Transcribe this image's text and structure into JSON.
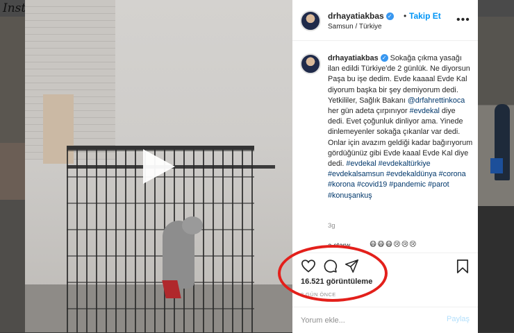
{
  "background": {
    "app_logo": "Instagram",
    "accent_annotation": "#e3201b"
  },
  "post": {
    "header": {
      "username": "drhayatiakbas",
      "verified_icon": "verified-badge-icon",
      "separator": "•",
      "follow_label": "Takip Et",
      "location": "Samsun / Türkiye",
      "more_icon": "more-options-icon"
    },
    "caption": {
      "username": "drhayatiakbas",
      "text_1": " Sokağa çıkma yasağı ilan edildi Türkiye'de 2 günlük. Ne diyorsun Paşa bu işe dedim. Evde kaaaal Evde Kal diyorum başka bir şey demiyorum dedi. Yetkililer, Sağlık Bakanı ",
      "mention": "@drfahrettinkoca",
      "text_2": " her gün adeta çırpınıyor ",
      "hashtag_1": "#evdekal",
      "text_3": " diye dedi. Evet çoğunluk dinliyor ama. Yinede dinlemeyenler sokağa çıkanlar var dedi. Onlar için avazım geldiği kadar bağırıyorum gördüğünüz gibi Evde kaaal Evde Kal diye dedi. ",
      "hashtags_rest": "#evdekal #evdekaltürkiye #evdekalsamsun #evdekaldünya #corona #korona #covid19 #pandemic #parot #konuşankuş",
      "time_ago": "3g"
    },
    "next_comment": {
      "username": "a.starw",
      "emoji": "😷😷😷😢😢😢"
    },
    "actions": {
      "like_icon": "heart-icon",
      "comment_icon": "comment-icon",
      "share_icon": "share-icon",
      "save_icon": "bookmark-icon",
      "views": "16.521 görüntüleme",
      "date": "3 GÜN ÖNCE"
    },
    "comment_box": {
      "placeholder": "Yorum ekle...",
      "post_label": "Paylaş"
    }
  },
  "video": {
    "play_icon": "play-icon"
  }
}
